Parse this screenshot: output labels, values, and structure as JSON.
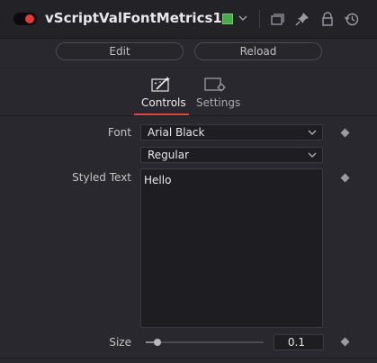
{
  "header": {
    "title": "vScriptValFontMetrics1",
    "color_swatch": "#4aa94a",
    "icons": [
      "version-icon",
      "pin-icon",
      "lock-icon",
      "reset-icon"
    ]
  },
  "toolbar": {
    "edit_label": "Edit",
    "reload_label": "Reload"
  },
  "tabs": [
    {
      "label": "Controls",
      "icon": "controls-wand-icon",
      "active": true
    },
    {
      "label": "Settings",
      "icon": "settings-icon",
      "active": false
    }
  ],
  "controls": {
    "font": {
      "label": "Font",
      "value": "Arial Black",
      "style_value": "Regular"
    },
    "styled_text": {
      "label": "Styled Text",
      "value": "Hello"
    },
    "size": {
      "label": "Size",
      "value": "0.1",
      "slider_fraction": 0.1
    }
  },
  "colors": {
    "accent": "#e0463c",
    "toggle_dot": "#e23a3a"
  }
}
